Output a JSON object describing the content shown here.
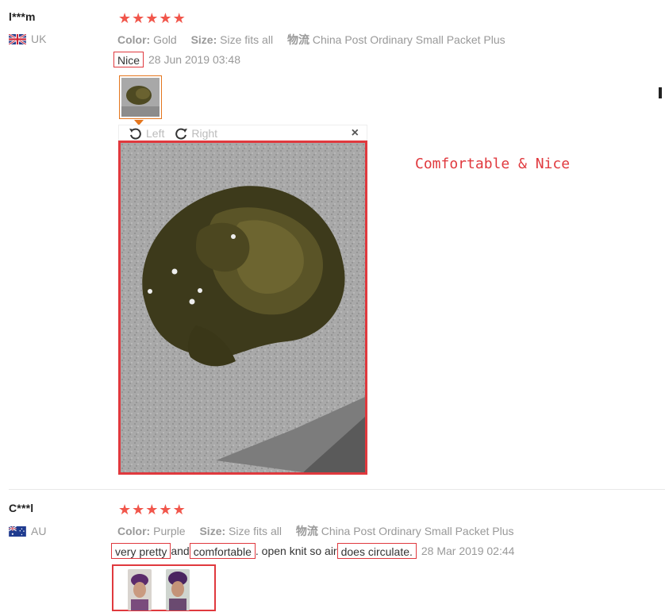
{
  "reviews": [
    {
      "name": "l***m",
      "country": "UK",
      "stars": 5,
      "color_label": "Color:",
      "color_value": "Gold",
      "size_label": "Size:",
      "size_value": "Size fits all",
      "ship_label": "物流",
      "ship_value": "China Post Ordinary Small Packet Plus",
      "comment": "Nice",
      "date": "28 Jun 2019 03:48",
      "viewer": {
        "left": "Left",
        "right": "Right",
        "close": "×"
      }
    },
    {
      "name": "C***l",
      "country": "AU",
      "stars": 5,
      "color_label": "Color:",
      "color_value": "Purple",
      "size_label": "Size:",
      "size_value": "Size fits all",
      "ship_label": "物流",
      "ship_value": "China Post Ordinary Small Packet Plus",
      "comment_parts": [
        " very pretty ",
        "and",
        "comfortable",
        ". open knit so air ",
        "does circulate."
      ],
      "date": "28 Mar 2019 02:44"
    }
  ],
  "annotation": "Comfortable & Nice",
  "colors": {
    "star": "#f1564b",
    "highlight": "#e0393e",
    "accent": "#e4761e"
  }
}
